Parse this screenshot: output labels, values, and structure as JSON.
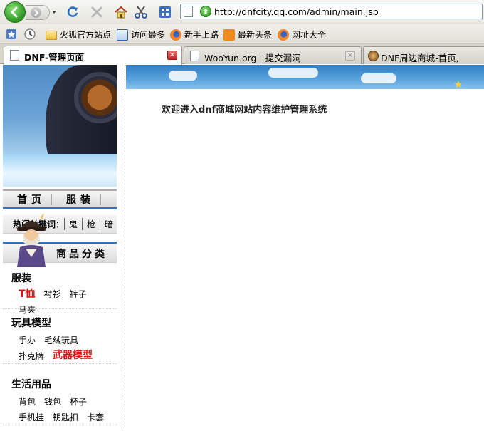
{
  "browser": {
    "url": "http://dnfcity.qq.com/admin/main.jsp"
  },
  "bookmarks": [
    {
      "label": "火狐官方站点",
      "icon": "folder-icon"
    },
    {
      "label": "访问最多",
      "icon": "magnifier-icon"
    },
    {
      "label": "新手上路",
      "icon": "firefox-icon"
    },
    {
      "label": "最新头条",
      "icon": "rss-icon"
    },
    {
      "label": "网址大全",
      "icon": "firefox-icon"
    }
  ],
  "tabs": [
    {
      "label": "DNF-管理页面",
      "active": true
    },
    {
      "label": "WooYun.org | 提交漏洞",
      "active": false
    },
    {
      "label": "DNF周边商城-首页,",
      "active": false
    }
  ],
  "sidebar": {
    "nav": [
      "首页",
      "服装"
    ],
    "hot_label": "热门关键词：",
    "hot_keywords": [
      "鬼",
      "枪",
      "暗"
    ],
    "category_title": "商品分类",
    "groups": [
      {
        "title": "服装",
        "items": [
          {
            "label": "T恤",
            "highlight": true
          },
          {
            "label": "衬衫",
            "highlight": false
          },
          {
            "label": "裤子",
            "highlight": false
          },
          {
            "label": "马夹",
            "highlight": false
          }
        ]
      },
      {
        "title": "玩具模型",
        "items": [
          {
            "label": "手办",
            "highlight": false
          },
          {
            "label": "毛绒玩具",
            "highlight": false
          },
          {
            "label": "扑克牌",
            "highlight": false
          },
          {
            "label": "武器模型",
            "highlight": true
          }
        ]
      },
      {
        "title": "生活用品",
        "items": [
          {
            "label": "背包",
            "highlight": false
          },
          {
            "label": "钱包",
            "highlight": false
          },
          {
            "label": "杯子",
            "highlight": false
          },
          {
            "label": "手机挂",
            "highlight": false
          },
          {
            "label": "钥匙扣",
            "highlight": false
          },
          {
            "label": "卡套",
            "highlight": false
          }
        ]
      }
    ]
  },
  "main": {
    "welcome": "欢迎进入dnf商城网站内容维护管理系统"
  },
  "colors": {
    "accent_blue": "#2b73c2",
    "highlight_red": "#e01010"
  }
}
